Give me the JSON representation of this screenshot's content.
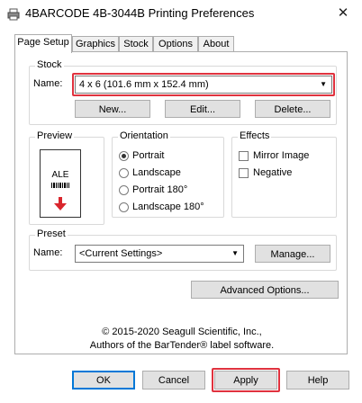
{
  "window": {
    "title": "4BARCODE 4B-3044B Printing Preferences"
  },
  "tabs": [
    {
      "label": "Page Setup"
    },
    {
      "label": "Graphics"
    },
    {
      "label": "Stock"
    },
    {
      "label": "Options"
    },
    {
      "label": "About"
    }
  ],
  "stock": {
    "group_label": "Stock",
    "name_label": "Name:",
    "selected": "4 x 6 (101.6 mm x 152.4 mm)",
    "new_label": "New...",
    "edit_label": "Edit...",
    "delete_label": "Delete..."
  },
  "preview": {
    "group_label": "Preview",
    "sample_text": "ALE"
  },
  "orientation": {
    "group_label": "Orientation",
    "options": [
      "Portrait",
      "Landscape",
      "Portrait 180°",
      "Landscape 180°"
    ],
    "selected": "Portrait"
  },
  "effects": {
    "group_label": "Effects",
    "options": [
      "Mirror Image",
      "Negative"
    ]
  },
  "preset": {
    "group_label": "Preset",
    "name_label": "Name:",
    "selected": "<Current Settings>",
    "manage_label": "Manage..."
  },
  "advanced_label": "Advanced Options...",
  "copyright": {
    "line1": "© 2015-2020 Seagull Scientific, Inc.,",
    "line2": "Authors of the BarTender® label software."
  },
  "footer": {
    "ok": "OK",
    "cancel": "Cancel",
    "apply": "Apply",
    "help": "Help"
  },
  "colors": {
    "highlight": "#e0323e",
    "default_button_border": "#0078d7",
    "arrow_red": "#d9262d"
  }
}
